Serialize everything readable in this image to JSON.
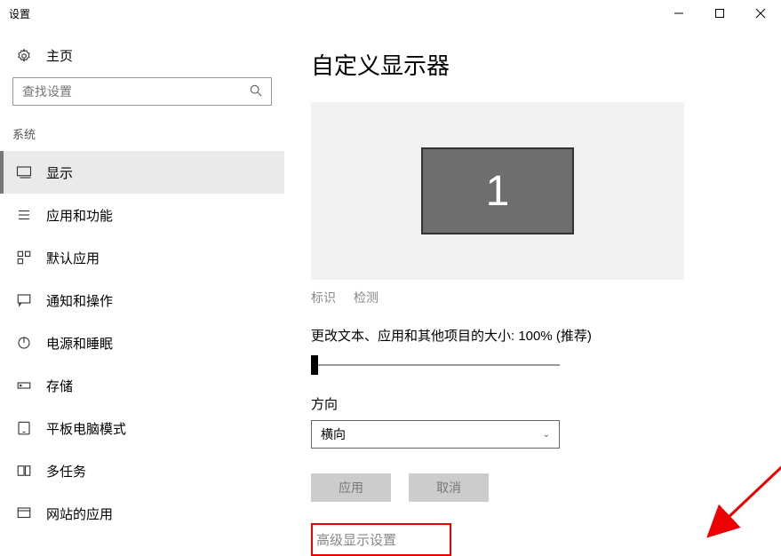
{
  "window": {
    "title": "设置"
  },
  "sidebar": {
    "home": "主页",
    "search_placeholder": "查找设置",
    "section": "系统",
    "items": [
      {
        "label": "显示"
      },
      {
        "label": "应用和功能"
      },
      {
        "label": "默认应用"
      },
      {
        "label": "通知和操作"
      },
      {
        "label": "电源和睡眠"
      },
      {
        "label": "存储"
      },
      {
        "label": "平板电脑模式"
      },
      {
        "label": "多任务"
      },
      {
        "label": "网站的应用"
      }
    ]
  },
  "main": {
    "title": "自定义显示器",
    "monitor_number": "1",
    "identify": "标识",
    "detect": "检测",
    "scale_label": "更改文本、应用和其他项目的大小: 100% (推荐)",
    "orientation_label": "方向",
    "orientation_value": "横向",
    "apply": "应用",
    "cancel": "取消",
    "advanced": "高级显示设置"
  }
}
